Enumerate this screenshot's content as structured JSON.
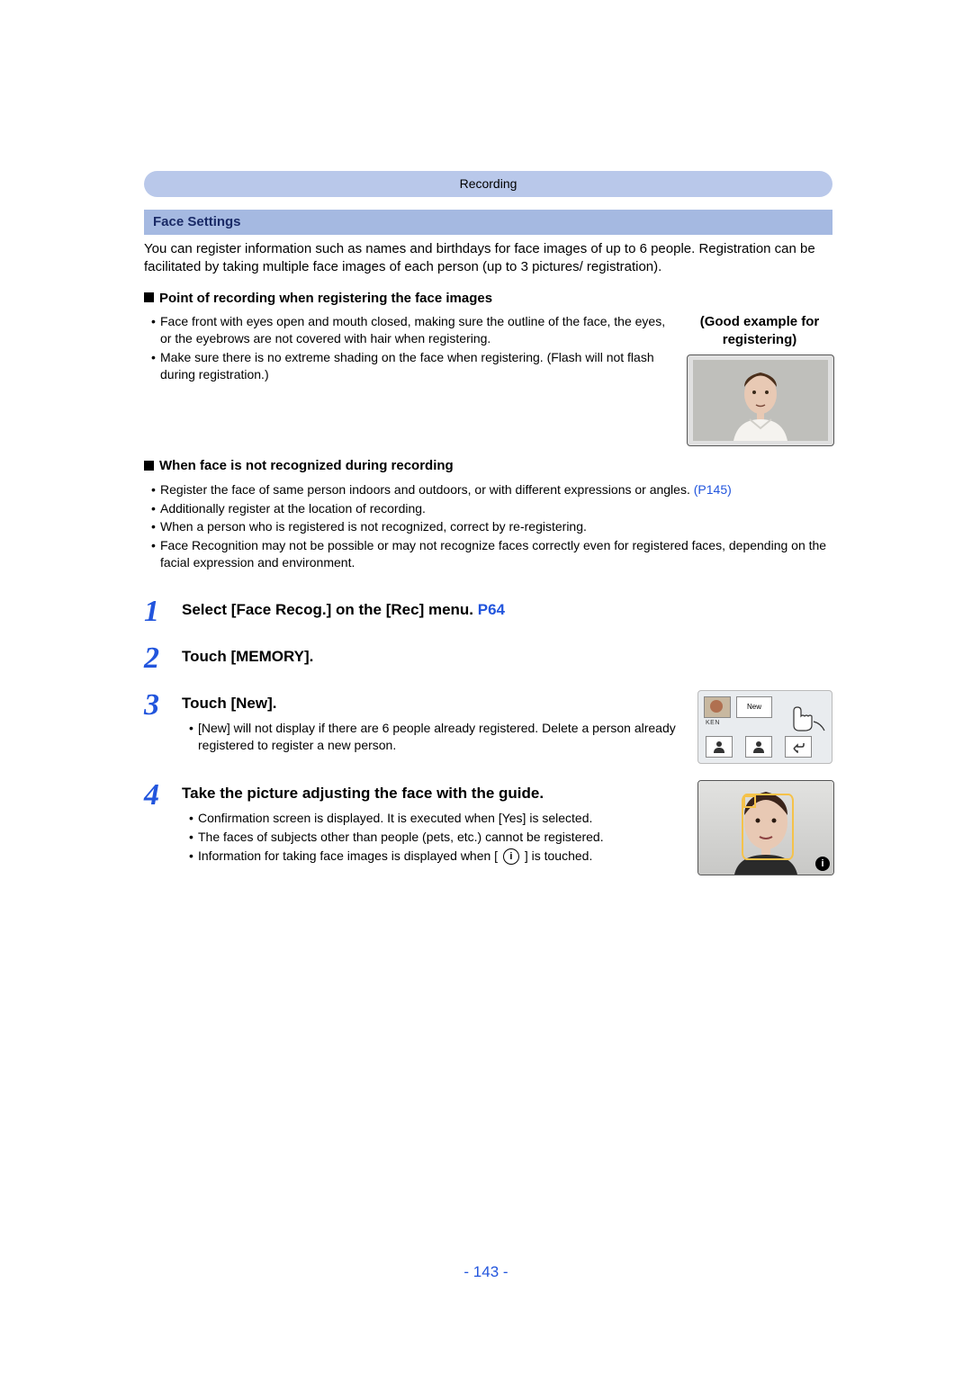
{
  "header": {
    "category": "Recording"
  },
  "section": {
    "title": "Face Settings",
    "intro": "You can register information such as names and birthdays for face images of up to 6 people. Registration can be facilitated by taking multiple face images of each person (up to 3 pictures/ registration)."
  },
  "sub1": {
    "title": "Point of recording when registering the face images",
    "bullets": [
      "Face front with eyes open and mouth closed, making sure the outline of the face, the eyes, or the eyebrows are not covered with hair when registering.",
      "Make sure there is no extreme shading on the face when registering. (Flash will not flash during registration.)"
    ],
    "example_label": "(Good example for registering)"
  },
  "sub2": {
    "title": "When face is not recognized during recording",
    "bullet1_text": "Register the face of same person indoors and outdoors, or with different expressions or angles.",
    "bullet1_link": "(P145)",
    "bullets_rest": [
      "Additionally register at the location of recording.",
      "When a person who is registered is not recognized, correct by re-registering.",
      "Face Recognition may not be possible or may not recognize faces correctly even for registered faces, depending on the facial expression and environment."
    ]
  },
  "steps": {
    "s1": {
      "num": "1",
      "title_pre": "Select [Face Recog.] on the [Rec] menu. ",
      "title_link": "P64"
    },
    "s2": {
      "num": "2",
      "title": "Touch [MEMORY]."
    },
    "s3": {
      "num": "3",
      "title": "Touch [New].",
      "note": "[New] will not display if there are 6 people already registered. Delete a person already registered to register a new person.",
      "ui": {
        "name_label": "KEN",
        "new_label": "New"
      }
    },
    "s4": {
      "num": "4",
      "title": "Take the picture adjusting the face with the guide.",
      "notes": [
        "Confirmation screen is displayed. It is executed when [Yes] is selected.",
        "The faces of subjects other than people (pets, etc.) cannot be registered."
      ],
      "note_info_pre": "Information for taking face images is displayed when [",
      "note_info_post": "] is touched.",
      "info_glyph": "i"
    }
  },
  "page_number": "- 143 -"
}
